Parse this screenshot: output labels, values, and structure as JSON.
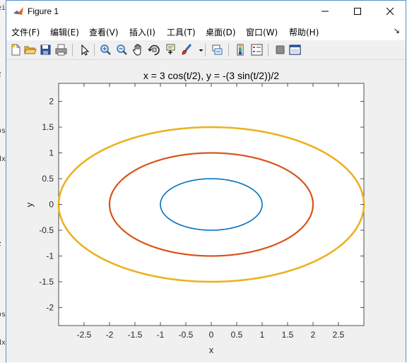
{
  "window": {
    "title": "Figure 1"
  },
  "menu": [
    {
      "key": "file",
      "label": "文件(F)"
    },
    {
      "key": "edit",
      "label": "编辑(E)"
    },
    {
      "key": "view",
      "label": "查看(V)"
    },
    {
      "key": "insert",
      "label": "插入(I)"
    },
    {
      "key": "tools",
      "label": "工具(T)"
    },
    {
      "key": "desktop",
      "label": "桌面(D)"
    },
    {
      "key": "window",
      "label": "窗口(W)"
    },
    {
      "key": "help",
      "label": "帮助(H)"
    }
  ],
  "toolbar": [
    {
      "name": "new-figure-icon"
    },
    {
      "name": "open-file-icon"
    },
    {
      "name": "save-icon"
    },
    {
      "name": "print-icon"
    },
    {
      "name": "edit-plot-icon"
    },
    {
      "name": "zoom-in-icon"
    },
    {
      "name": "zoom-out-icon"
    },
    {
      "name": "pan-icon"
    },
    {
      "name": "rotate-3d-icon"
    },
    {
      "name": "data-cursor-icon"
    },
    {
      "name": "brush-icon"
    },
    {
      "name": "link-plot-icon"
    },
    {
      "name": "insert-colorbar-icon"
    },
    {
      "name": "insert-legend-icon"
    },
    {
      "name": "hide-plot-tools-icon"
    },
    {
      "name": "show-plot-tools-icon"
    }
  ],
  "chart_data": {
    "type": "line",
    "title": "x = 3 cos(t/2), y = -(3 sin(t/2))/2",
    "xlabel": "x",
    "ylabel": "y",
    "xlim": [
      -3,
      3
    ],
    "ylim": [
      -2.35,
      2.35
    ],
    "xticks": [
      -2.5,
      -2,
      -1.5,
      -1,
      -0.5,
      0,
      0.5,
      1,
      1.5,
      2,
      2.5
    ],
    "yticks": [
      -2,
      -1.5,
      -1,
      -0.5,
      0,
      0.5,
      1,
      1.5,
      2
    ],
    "xtick_labels": [
      "-2.5",
      "-2",
      "-1.5",
      "-1",
      "-0.5",
      "0",
      "0.5",
      "1",
      "1.5",
      "2",
      "2.5"
    ],
    "ytick_labels": [
      "-2",
      "-1.5",
      "-1",
      "-0.5",
      "0",
      "0.5",
      "1",
      "1.5",
      "2"
    ],
    "grid": false,
    "series": [
      {
        "semi_axis_x": 1,
        "semi_axis_y": 0.5,
        "color": "#0072bd"
      },
      {
        "semi_axis_x": 2,
        "semi_axis_y": 1,
        "color": "#d95319"
      },
      {
        "semi_axis_x": 3,
        "semi_axis_y": 1.5,
        "color": "#edb120"
      }
    ]
  },
  "colors": {
    "accent": "#0078d7",
    "background": "#f0f0f0"
  }
}
